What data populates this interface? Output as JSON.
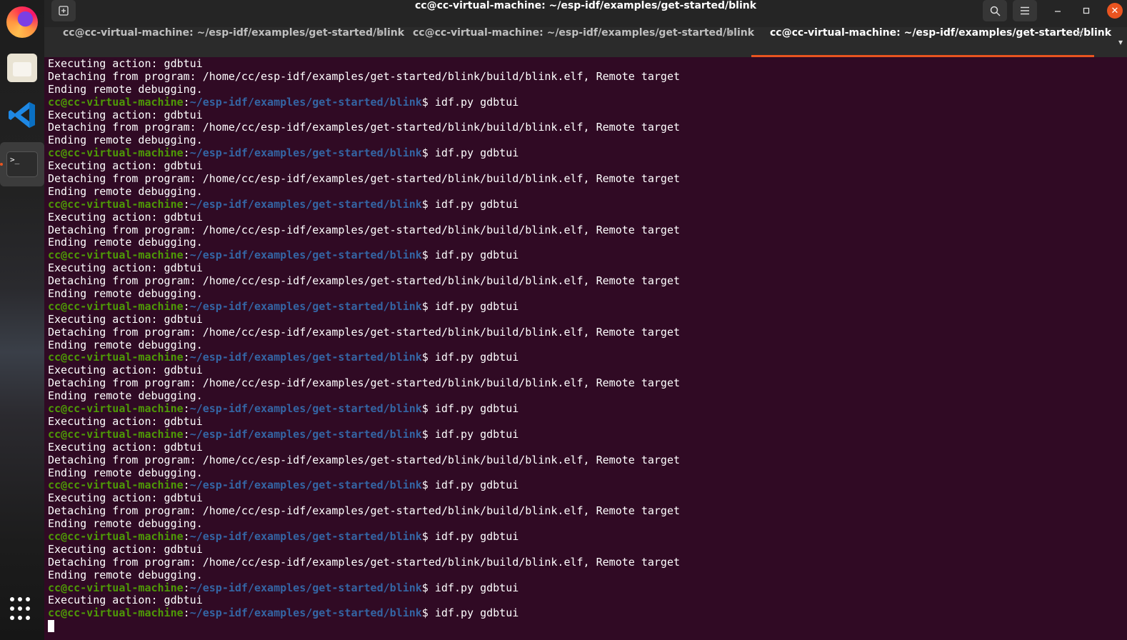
{
  "window": {
    "title": "cc@cc-virtual-machine: ~/esp-idf/examples/get-started/blink",
    "buttons": {
      "new_tab": "new-tab-icon",
      "search": "search-icon",
      "menu": "hamburger-icon",
      "minimize": "minimize-icon",
      "maximize": "maximize-icon",
      "close": "close-icon"
    }
  },
  "dock": {
    "items": [
      "firefox-icon",
      "files-icon",
      "vscode-icon",
      "terminal-icon"
    ],
    "apps_grid": "apps-grid-icon"
  },
  "tabs": [
    {
      "label": "cc@cc-virtual-machine: ~/esp-idf/examples/get-started/blink",
      "close": "×",
      "active": false
    },
    {
      "label": "cc@cc-virtual-machine: ~/esp-idf/examples/get-started/blink",
      "close": "×",
      "active": false
    },
    {
      "label": "cc@cc-virtual-machine: ~/esp-idf/examples/get-started/blink",
      "close": "×",
      "active": true
    }
  ],
  "tab_overflow": "▾",
  "colors": {
    "terminal_bg": "#300a24",
    "prompt_user": "#4e9a06",
    "prompt_path": "#3465a4",
    "accent": "#e95420"
  },
  "terminal": {
    "prompt_user": "cc@cc-virtual-machine",
    "prompt_path": "~/esp-idf/examples/get-started/blink",
    "lines": [
      {
        "type": "out",
        "text": "Executing action: gdbtui"
      },
      {
        "type": "out",
        "text": "Detaching from program: /home/cc/esp-idf/examples/get-started/blink/build/blink.elf, Remote target"
      },
      {
        "type": "out",
        "text": "Ending remote debugging."
      },
      {
        "type": "prompt",
        "cmd": "$ idf.py gdbtui"
      },
      {
        "type": "out",
        "text": "Executing action: gdbtui"
      },
      {
        "type": "out",
        "text": "Detaching from program: /home/cc/esp-idf/examples/get-started/blink/build/blink.elf, Remote target"
      },
      {
        "type": "out",
        "text": "Ending remote debugging."
      },
      {
        "type": "prompt",
        "cmd": "$ idf.py gdbtui"
      },
      {
        "type": "out",
        "text": "Executing action: gdbtui"
      },
      {
        "type": "out",
        "text": "Detaching from program: /home/cc/esp-idf/examples/get-started/blink/build/blink.elf, Remote target"
      },
      {
        "type": "out",
        "text": "Ending remote debugging."
      },
      {
        "type": "prompt",
        "cmd": "$ idf.py gdbtui"
      },
      {
        "type": "out",
        "text": "Executing action: gdbtui"
      },
      {
        "type": "out",
        "text": "Detaching from program: /home/cc/esp-idf/examples/get-started/blink/build/blink.elf, Remote target"
      },
      {
        "type": "out",
        "text": "Ending remote debugging."
      },
      {
        "type": "prompt",
        "cmd": "$ idf.py gdbtui"
      },
      {
        "type": "out",
        "text": "Executing action: gdbtui"
      },
      {
        "type": "out",
        "text": "Detaching from program: /home/cc/esp-idf/examples/get-started/blink/build/blink.elf, Remote target"
      },
      {
        "type": "out",
        "text": "Ending remote debugging."
      },
      {
        "type": "prompt",
        "cmd": "$ idf.py gdbtui"
      },
      {
        "type": "out",
        "text": "Executing action: gdbtui"
      },
      {
        "type": "out",
        "text": "Detaching from program: /home/cc/esp-idf/examples/get-started/blink/build/blink.elf, Remote target"
      },
      {
        "type": "out",
        "text": "Ending remote debugging."
      },
      {
        "type": "prompt",
        "cmd": "$ idf.py gdbtui"
      },
      {
        "type": "out",
        "text": "Executing action: gdbtui"
      },
      {
        "type": "out",
        "text": "Detaching from program: /home/cc/esp-idf/examples/get-started/blink/build/blink.elf, Remote target"
      },
      {
        "type": "out",
        "text": "Ending remote debugging."
      },
      {
        "type": "prompt",
        "cmd": "$ idf.py gdbtui"
      },
      {
        "type": "out",
        "text": "Executing action: gdbtui"
      },
      {
        "type": "prompt",
        "cmd": "$ idf.py gdbtui"
      },
      {
        "type": "out",
        "text": "Executing action: gdbtui"
      },
      {
        "type": "out",
        "text": "Detaching from program: /home/cc/esp-idf/examples/get-started/blink/build/blink.elf, Remote target"
      },
      {
        "type": "out",
        "text": "Ending remote debugging."
      },
      {
        "type": "prompt",
        "cmd": "$ idf.py gdbtui"
      },
      {
        "type": "out",
        "text": "Executing action: gdbtui"
      },
      {
        "type": "out",
        "text": "Detaching from program: /home/cc/esp-idf/examples/get-started/blink/build/blink.elf, Remote target"
      },
      {
        "type": "out",
        "text": "Ending remote debugging."
      },
      {
        "type": "prompt",
        "cmd": "$ idf.py gdbtui"
      },
      {
        "type": "out",
        "text": "Executing action: gdbtui"
      },
      {
        "type": "out",
        "text": "Detaching from program: /home/cc/esp-idf/examples/get-started/blink/build/blink.elf, Remote target"
      },
      {
        "type": "out",
        "text": "Ending remote debugging."
      },
      {
        "type": "prompt",
        "cmd": "$ idf.py gdbtui"
      },
      {
        "type": "out",
        "text": "Executing action: gdbtui"
      },
      {
        "type": "prompt",
        "cmd": "$ idf.py gdbtui"
      },
      {
        "type": "cursor"
      }
    ]
  }
}
